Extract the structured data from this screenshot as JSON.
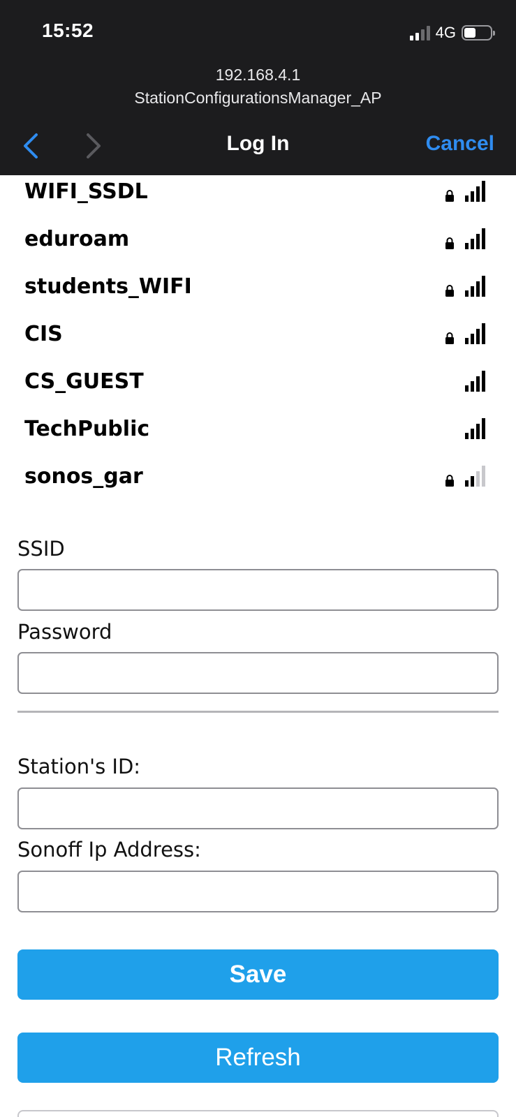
{
  "status_bar": {
    "time": "15:52",
    "network": "4G",
    "battery_fraction": 0.45
  },
  "browser": {
    "url": "192.168.4.1",
    "page_title": "StationConfigurationsManager_AP",
    "nav_title": "Log In",
    "cancel_label": "Cancel"
  },
  "networks": [
    {
      "name": "WIFI_SSDL",
      "locked": true,
      "signal_bars": 4
    },
    {
      "name": "eduroam",
      "locked": true,
      "signal_bars": 4
    },
    {
      "name": "students_WIFI",
      "locked": true,
      "signal_bars": 4
    },
    {
      "name": "CIS",
      "locked": true,
      "signal_bars": 4
    },
    {
      "name": "CS_GUEST",
      "locked": false,
      "signal_bars": 4
    },
    {
      "name": "TechPublic",
      "locked": false,
      "signal_bars": 4
    },
    {
      "name": "sonos_gar",
      "locked": true,
      "signal_bars": 2
    }
  ],
  "form": {
    "ssid_label": "SSID",
    "ssid_value": "",
    "password_label": "Password",
    "password_value": "",
    "station_id_label": "Station's ID:",
    "station_id_value": "",
    "sonoff_ip_label": "Sonoff Ip Address:",
    "sonoff_ip_value": ""
  },
  "buttons": {
    "save_label": "Save",
    "refresh_label": "Refresh"
  },
  "colors": {
    "accent": "#2f8cf0",
    "button": "#1fa0ea",
    "topbar": "#1c1c1e"
  }
}
